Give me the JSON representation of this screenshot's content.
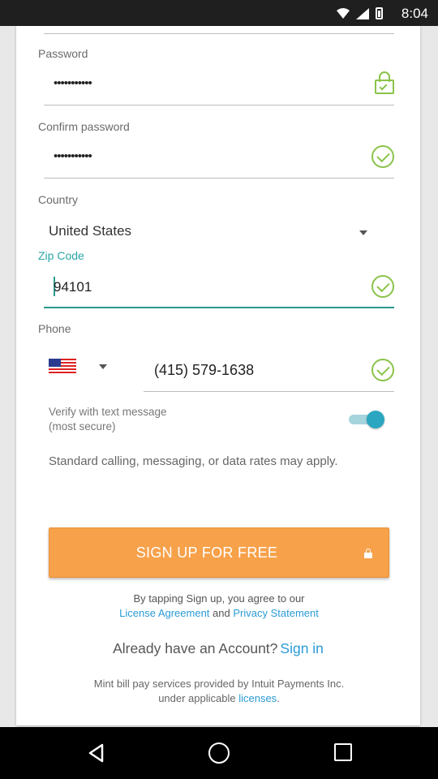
{
  "status_bar": {
    "time": "8:04"
  },
  "form": {
    "password": {
      "label": "Password",
      "value": "•••••••••••"
    },
    "confirm_password": {
      "label": "Confirm password",
      "value": "•••••••••••"
    },
    "country": {
      "label": "Country",
      "value": "United States"
    },
    "zip": {
      "label": "Zip Code",
      "value": "94101"
    },
    "phone": {
      "label": "Phone",
      "value": "(415) 579-1638"
    },
    "verify": {
      "line1": "Verify with text message",
      "line2": "(most secure)",
      "enabled": true
    },
    "disclaimer": "Standard calling, messaging, or data rates may apply."
  },
  "signup": {
    "button_label": "SIGN UP FOR FREE",
    "agree_prefix": "By tapping Sign up, you agree to our",
    "license_link": "License Agreement",
    "and": "and",
    "privacy_link": "Privacy Statement",
    "account_prompt": "Already have an Account?",
    "signin_link": "Sign in"
  },
  "footer": {
    "text": "Mint bill pay services provided by Intuit Payments Inc.",
    "text2_prefix": "under applicable",
    "licenses_link": "licenses",
    "text2_suffix": "."
  },
  "colors": {
    "accent": "#f7a14a",
    "teal": "#2a9b8f",
    "check": "#8bc34a",
    "link": "#2a9bd6"
  },
  "icons": [
    "wifi-icon",
    "signal-icon",
    "battery-icon",
    "lock-check-icon",
    "check-circle-icon",
    "chevron-down-icon",
    "us-flag-icon",
    "lock-icon",
    "back-icon",
    "home-icon",
    "recents-icon"
  ]
}
